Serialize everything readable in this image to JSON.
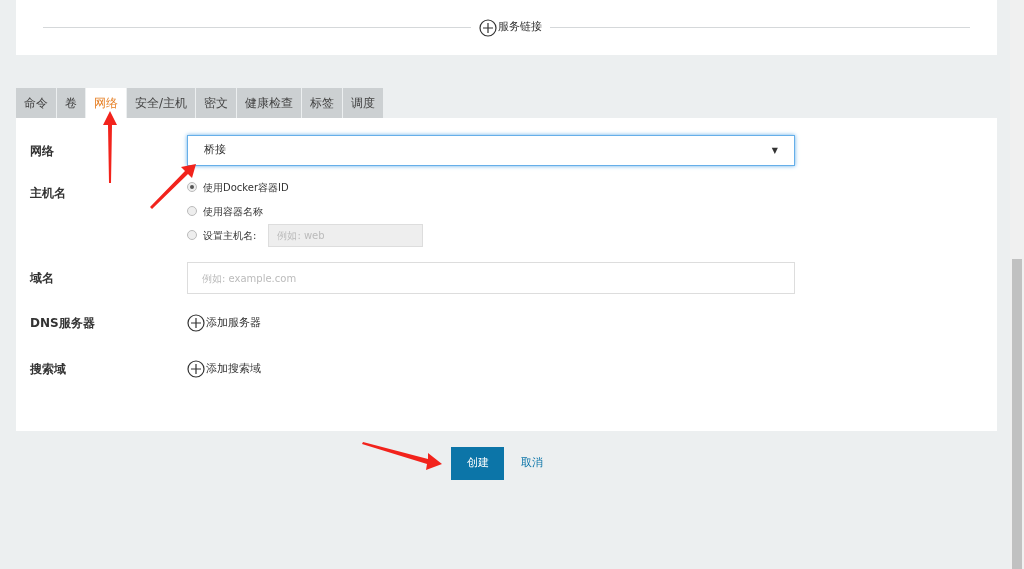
{
  "top_card": {
    "add_link": {
      "label": "服务链接"
    }
  },
  "tabs": [
    {
      "label": "命令",
      "selected": false
    },
    {
      "label": "卷",
      "selected": false
    },
    {
      "label": "网络",
      "selected": true
    },
    {
      "label": "安全/主机",
      "selected": false
    },
    {
      "label": "密文",
      "selected": false
    },
    {
      "label": "健康检查",
      "selected": false
    },
    {
      "label": "标签",
      "selected": false
    },
    {
      "label": "调度",
      "selected": false
    }
  ],
  "network": {
    "label": "网络",
    "value": "桥接",
    "arrow": "▼"
  },
  "hostname": {
    "label": "主机名",
    "options": [
      {
        "label": "使用Docker容器ID",
        "selected": true
      },
      {
        "label": "使用容器名称",
        "selected": false
      },
      {
        "label": "设置主机名:",
        "selected": false,
        "placeholder": "例如: web"
      }
    ]
  },
  "domain": {
    "label": "域名",
    "placeholder": "例如: example.com"
  },
  "dns": {
    "label": "DNS服务器",
    "add_label": "添加服务器"
  },
  "search_domain": {
    "label": "搜索域",
    "add_label": "添加搜索域"
  },
  "buttons": {
    "create": "创建",
    "cancel": "取消"
  }
}
